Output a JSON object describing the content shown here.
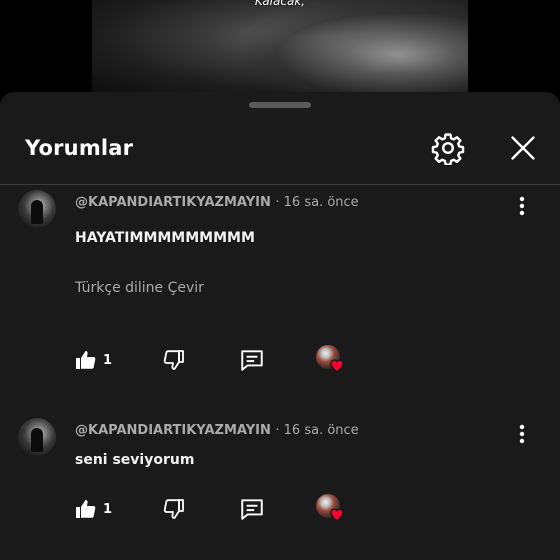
{
  "video": {
    "caption": "Kalacak,"
  },
  "header": {
    "title": "Yorumlar",
    "settings_icon": "gear-icon",
    "close_icon": "close-icon"
  },
  "comments": [
    {
      "author": "@KAPANDIARTIKYAZMAYIN",
      "time": "· 16 sa. önce",
      "text": "HAYATIMMMMMMMMM",
      "translate": "Türkçe diline Çevir",
      "likes": "1"
    },
    {
      "author": "@KAPANDIARTIKYAZMAYIN",
      "time": "· 16 sa. önce",
      "text": "seni seviyorum",
      "likes": "1"
    }
  ],
  "colors": {
    "sheet_bg": "#1a1a1a",
    "heart": "#ff0033",
    "meta_text": "#aaaaaa"
  }
}
